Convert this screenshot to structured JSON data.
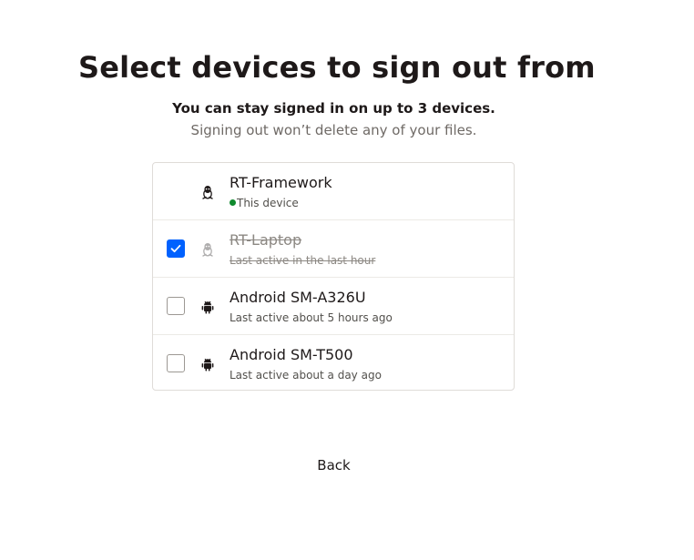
{
  "page": {
    "title": "Select devices to sign out from",
    "subtitle": "You can stay signed in on up to 3 devices.",
    "note": "Signing out won’t delete any of your files."
  },
  "devices": [
    {
      "name": "RT-Framework",
      "status": "This device",
      "icon": "linux-icon",
      "checkbox": "none",
      "current": true
    },
    {
      "name": "RT-Laptop",
      "status": "Last active in the last hour",
      "icon": "linux-icon",
      "checkbox": "checked",
      "struck": true
    },
    {
      "name": "Android SM-A326U",
      "status": "Last active about 5 hours ago",
      "icon": "android-icon",
      "checkbox": "unchecked"
    },
    {
      "name": "Android SM-T500",
      "status": "Last active about a day ago",
      "icon": "android-icon",
      "checkbox": "unchecked"
    }
  ],
  "actions": {
    "back_label": "Back"
  },
  "colors": {
    "accent": "#0061fe",
    "online": "#0f8a2e",
    "text": "#1e1919",
    "muted": "#6f6a66"
  }
}
